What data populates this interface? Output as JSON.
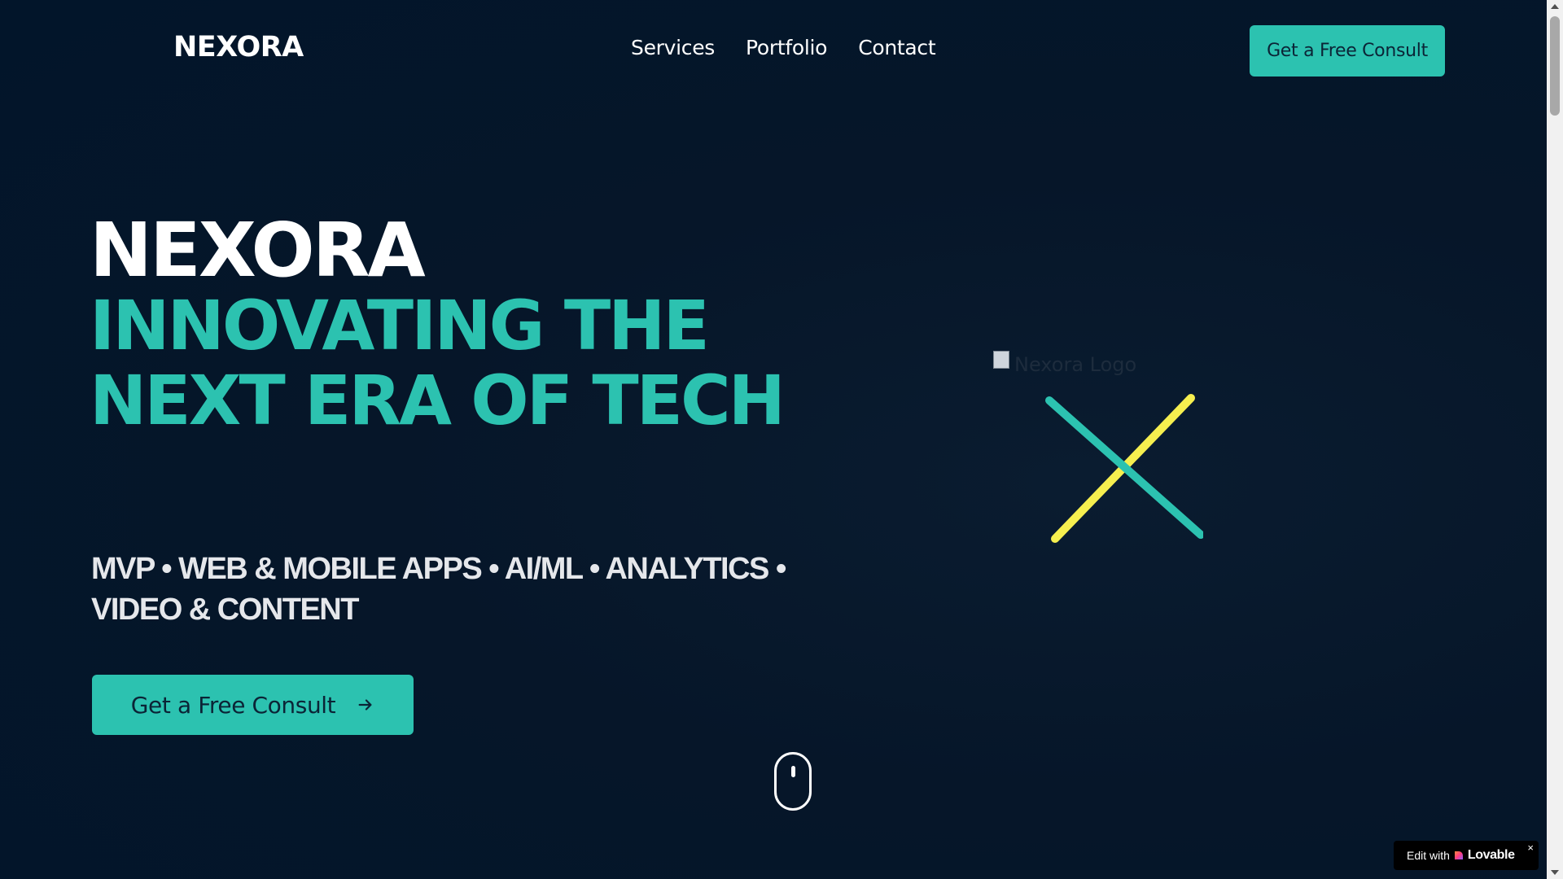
{
  "header": {
    "brand": "NEXORA",
    "nav": [
      "Services",
      "Portfolio",
      "Contact"
    ],
    "cta_label": "Get a Free Consult"
  },
  "hero": {
    "title_line_1": "NEXORA",
    "title_line_2": "INNOVATING THE NEXT ERA OF TECH",
    "subtitle": "MVP • WEB & MOBILE APPS • AI/ML • ANALYTICS • VIDEO & CONTENT",
    "cta_label": "Get a Free Consult",
    "cta_icon": "arrow-right-icon"
  },
  "logo": {
    "alt_text": "Nexora Logo",
    "colors": {
      "teal": "#2cc2b0",
      "yellow": "#f6ef4f"
    }
  },
  "scroll_indicator": {
    "icon": "mouse-scroll-icon"
  },
  "badge": {
    "prefix": "Edit with",
    "brand": "Lovable",
    "close": "×"
  },
  "colors": {
    "background": "#03162a",
    "accent": "#2cc2b0",
    "text": "#ffffff",
    "button_text": "#0b2436"
  }
}
